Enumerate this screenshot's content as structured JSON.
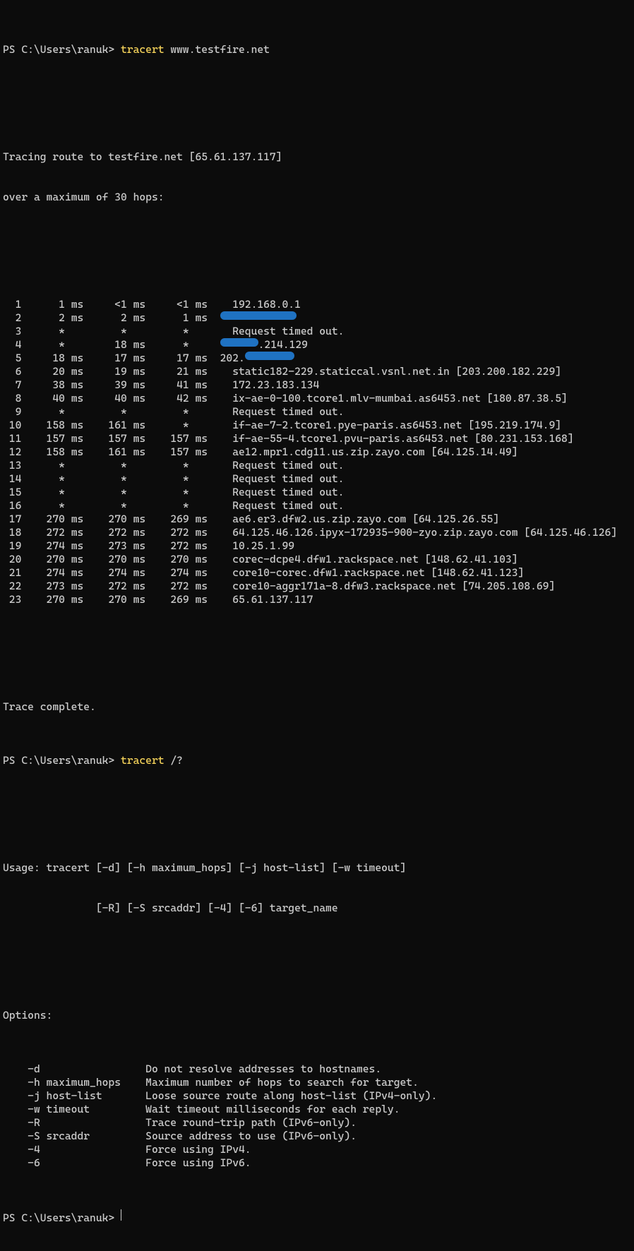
{
  "prompt": "PS C:\\Users\\ranuk> ",
  "cmd1_tracert": "tracert",
  "cmd1_arg": " www.testfire.net",
  "cmd2_tracert": "tracert",
  "cmd2_arg": " /?",
  "resolve_l1": "Tracing route to testfire.net [65.61.137.117]",
  "resolve_l2": "over a maximum of 30 hops:",
  "hops": [
    {
      "n": "  1",
      "t1": "    1 ms",
      "t2": "   <1 ms",
      "t3": "   <1 ms",
      "dest": "  192.168.0.1",
      "redactW": 0,
      "pre": ""
    },
    {
      "n": "  2",
      "t1": "    2 ms",
      "t2": "    2 ms",
      "t3": "    1 ms",
      "dest": "",
      "redactW": 108,
      "pre": ""
    },
    {
      "n": "  3",
      "t1": "    *   ",
      "t2": "    *   ",
      "t3": "    *   ",
      "dest": "  Request timed out.",
      "redactW": 0,
      "pre": ""
    },
    {
      "n": "  4",
      "t1": "    *   ",
      "t2": "   18 ms",
      "t3": "    *   ",
      "dest": ".214.129",
      "redactW": 54,
      "pre": ""
    },
    {
      "n": "  5",
      "t1": "   18 ms",
      "t2": "   17 ms",
      "t3": "   17 ms",
      "dest": "",
      "redactW": 70,
      "pre": "202."
    },
    {
      "n": "  6",
      "t1": "   20 ms",
      "t2": "   19 ms",
      "t3": "   21 ms",
      "dest": "  static182-229.staticcal.vsnl.net.in [203.200.182.229]",
      "redactW": 0,
      "pre": ""
    },
    {
      "n": "  7",
      "t1": "   38 ms",
      "t2": "   39 ms",
      "t3": "   41 ms",
      "dest": "  172.23.183.134",
      "redactW": 0,
      "pre": ""
    },
    {
      "n": "  8",
      "t1": "   40 ms",
      "t2": "   40 ms",
      "t3": "   42 ms",
      "dest": "  ix-ae-0-100.tcore1.mlv-mumbai.as6453.net [180.87.38.5]",
      "redactW": 0,
      "pre": ""
    },
    {
      "n": "  9",
      "t1": "    *   ",
      "t2": "    *   ",
      "t3": "    *   ",
      "dest": "  Request timed out.",
      "redactW": 0,
      "pre": ""
    },
    {
      "n": " 10",
      "t1": "  158 ms",
      "t2": "  161 ms",
      "t3": "    *   ",
      "dest": "  if-ae-7-2.tcore1.pye-paris.as6453.net [195.219.174.9]",
      "redactW": 0,
      "pre": ""
    },
    {
      "n": " 11",
      "t1": "  157 ms",
      "t2": "  157 ms",
      "t3": "  157 ms",
      "dest": "  if-ae-55-4.tcore1.pvu-paris.as6453.net [80.231.153.168]",
      "redactW": 0,
      "pre": ""
    },
    {
      "n": " 12",
      "t1": "  158 ms",
      "t2": "  161 ms",
      "t3": "  157 ms",
      "dest": "  ae12.mpr1.cdg11.us.zip.zayo.com [64.125.14.49]",
      "redactW": 0,
      "pre": ""
    },
    {
      "n": " 13",
      "t1": "    *   ",
      "t2": "    *   ",
      "t3": "    *   ",
      "dest": "  Request timed out.",
      "redactW": 0,
      "pre": ""
    },
    {
      "n": " 14",
      "t1": "    *   ",
      "t2": "    *   ",
      "t3": "    *   ",
      "dest": "  Request timed out.",
      "redactW": 0,
      "pre": ""
    },
    {
      "n": " 15",
      "t1": "    *   ",
      "t2": "    *   ",
      "t3": "    *   ",
      "dest": "  Request timed out.",
      "redactW": 0,
      "pre": ""
    },
    {
      "n": " 16",
      "t1": "    *   ",
      "t2": "    *   ",
      "t3": "    *   ",
      "dest": "  Request timed out.",
      "redactW": 0,
      "pre": ""
    },
    {
      "n": " 17",
      "t1": "  270 ms",
      "t2": "  270 ms",
      "t3": "  269 ms",
      "dest": "  ae6.er3.dfw2.us.zip.zayo.com [64.125.26.55]",
      "redactW": 0,
      "pre": ""
    },
    {
      "n": " 18",
      "t1": "  272 ms",
      "t2": "  272 ms",
      "t3": "  272 ms",
      "dest": "  64.125.46.126.ipyx-172935-900-zyo.zip.zayo.com [64.125.46.126]",
      "redactW": 0,
      "pre": ""
    },
    {
      "n": " 19",
      "t1": "  274 ms",
      "t2": "  273 ms",
      "t3": "  272 ms",
      "dest": "  10.25.1.99",
      "redactW": 0,
      "pre": ""
    },
    {
      "n": " 20",
      "t1": "  270 ms",
      "t2": "  270 ms",
      "t3": "  270 ms",
      "dest": "  corec-dcpe4.dfw1.rackspace.net [148.62.41.103]",
      "redactW": 0,
      "pre": ""
    },
    {
      "n": " 21",
      "t1": "  274 ms",
      "t2": "  274 ms",
      "t3": "  274 ms",
      "dest": "  core10-corec.dfw1.rackspace.net [148.62.41.123]",
      "redactW": 0,
      "pre": ""
    },
    {
      "n": " 22",
      "t1": "  273 ms",
      "t2": "  272 ms",
      "t3": "  272 ms",
      "dest": "  core10-aggr171a-8.dfw3.rackspace.net [74.205.108.69]",
      "redactW": 0,
      "pre": ""
    },
    {
      "n": " 23",
      "t1": "  270 ms",
      "t2": "  270 ms",
      "t3": "  269 ms",
      "dest": "  65.61.137.117",
      "redactW": 0,
      "pre": ""
    }
  ],
  "trace_done": "Trace complete.",
  "usage_l1": "Usage: tracert [-d] [-h maximum_hops] [-j host-list] [-w timeout]",
  "usage_l2": "               [-R] [-S srcaddr] [-4] [-6] target_name",
  "options_hdr": "Options:",
  "options": [
    {
      "flag": "    -d             ",
      "desc": "    Do not resolve addresses to hostnames."
    },
    {
      "flag": "    -h maximum_hops",
      "desc": "    Maximum number of hops to search for target."
    },
    {
      "flag": "    -j host-list   ",
      "desc": "    Loose source route along host-list (IPv4-only)."
    },
    {
      "flag": "    -w timeout     ",
      "desc": "    Wait timeout milliseconds for each reply."
    },
    {
      "flag": "    -R             ",
      "desc": "    Trace round-trip path (IPv6-only)."
    },
    {
      "flag": "    -S srcaddr     ",
      "desc": "    Source address to use (IPv6-only)."
    },
    {
      "flag": "    -4             ",
      "desc": "    Force using IPv4."
    },
    {
      "flag": "    -6             ",
      "desc": "    Force using IPv6."
    }
  ]
}
